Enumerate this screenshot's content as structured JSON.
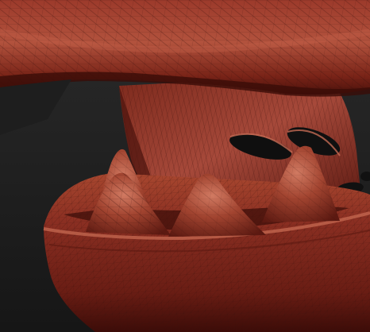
{
  "viewport": {
    "kind": "3d-sculpt-viewport",
    "subject": "creature-mouth-mesh",
    "shading": "wireframe-over-clay",
    "visible_text": []
  },
  "colors": {
    "background_top": "#333333",
    "background_bottom": "#151515",
    "clay_dark": "#5a1610",
    "clay_mid": "#8f3022",
    "clay_light": "#c96b53",
    "wire": "#3a0f0b",
    "highlight": "#e08a72"
  }
}
